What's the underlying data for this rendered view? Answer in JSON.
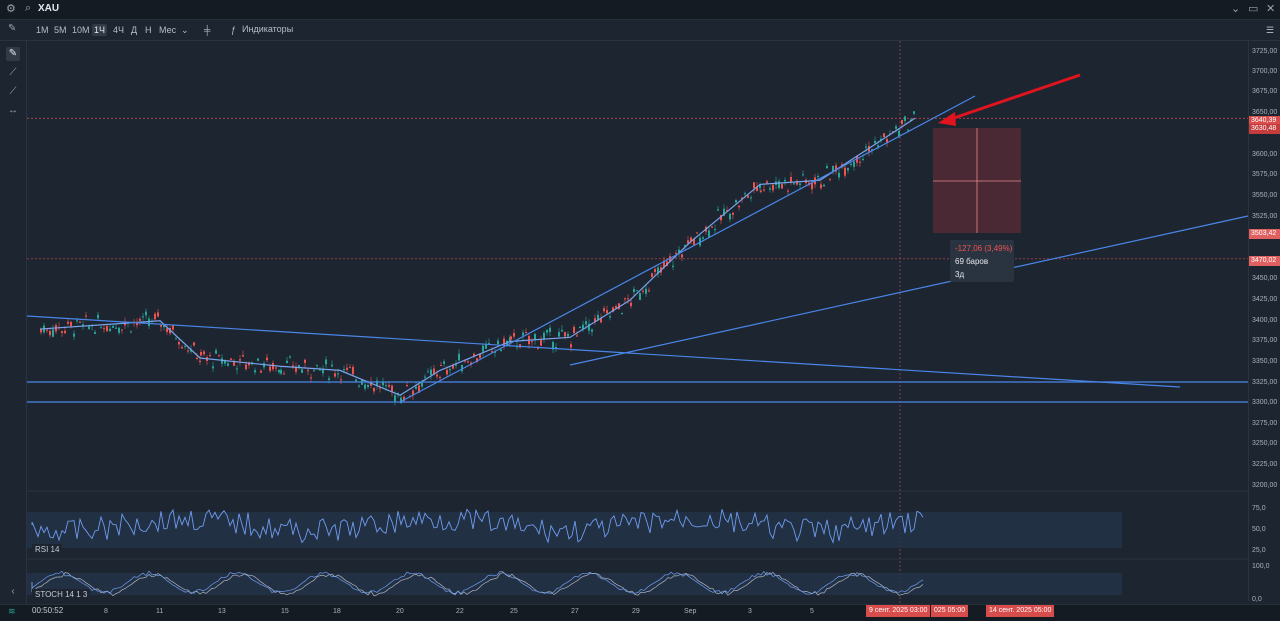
{
  "topbar": {
    "symbol": "XAU"
  },
  "toolbar": {
    "timeframes": [
      "1M",
      "5M",
      "10M",
      "1Ч",
      "4Ч",
      "Д",
      "Н",
      "Мес"
    ],
    "active_timeframe": "1Ч",
    "indicators_label": "Индикаторы"
  },
  "price_axis": {
    "ticks": [
      "3725,00",
      "3700,00",
      "3675,00",
      "3650,00",
      "3600,00",
      "3575,00",
      "3550,00",
      "3525,00",
      "3450,00",
      "3425,00",
      "3400,00",
      "3375,00",
      "3350,00",
      "3325,00",
      "3300,00",
      "3275,00",
      "3250,00",
      "3225,00",
      "3200,00"
    ],
    "labels": {
      "last": "3640,39",
      "current": "3630,48",
      "target": "3503,42",
      "level": "3470,02"
    },
    "label_colors": {
      "last": "#d94c4c",
      "current": "#d94c4c",
      "target": "#e06060",
      "level": "#e06060"
    }
  },
  "measure": {
    "change": "-127,06 (3,49%)",
    "bars": "69 баров",
    "days": "3д"
  },
  "rsi": {
    "label": "RSI 14",
    "ticks": [
      "75,0",
      "50,0",
      "25,0"
    ]
  },
  "stoch": {
    "label": "STOCH 14 1 3",
    "ticks": [
      "100,0",
      "0,0"
    ]
  },
  "time_axis": {
    "ticks": [
      "8",
      "11",
      "13",
      "15",
      "18",
      "20",
      "22",
      "25",
      "27",
      "29",
      "Sep",
      "3",
      "5"
    ],
    "cursor_label": "9 сент. 2025 03:00",
    "cursor_label_2": "025 05:00",
    "end_label": "14 сент. 2025 05:00"
  },
  "status": {
    "clock": "00:50:52"
  },
  "colors": {
    "background": "#1c2530",
    "trendline": "#4a86e8",
    "up": "#26a69a",
    "down": "#ef5350",
    "arrow": "#e0141e"
  },
  "chart_data": {
    "type": "line",
    "title": "",
    "xlabel": "",
    "ylabel": "",
    "ylim": [
      3200,
      3725
    ],
    "x": [
      "8",
      "11",
      "13",
      "15",
      "18",
      "20",
      "22",
      "25",
      "27",
      "29",
      "Sep",
      "3",
      "5",
      "9"
    ],
    "series": [
      {
        "values": [
          3385,
          3395,
          3350,
          3340,
          3335,
          3305,
          3335,
          3370,
          3375,
          3420,
          3490,
          3560,
          3565,
          3640
        ]
      }
    ]
  }
}
